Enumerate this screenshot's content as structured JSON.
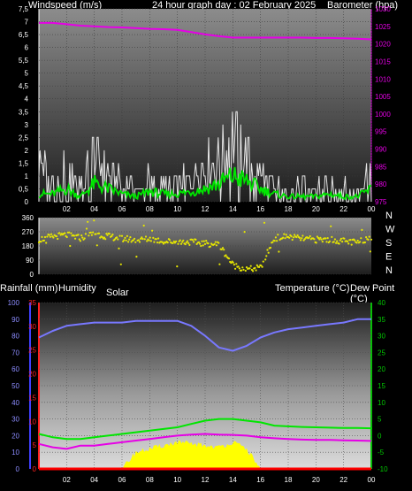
{
  "header": {
    "left": "Windspeed (m/s)",
    "center": "24 hour graph day : 02 February 2025",
    "right": "Barometer (hpa)"
  },
  "lower_header": {
    "rain": "Rainfall (mm)",
    "humidity": "Humidity",
    "solar": "Solar",
    "temperature": "Temperature (°C)",
    "dewpoint": "Dew Point (°C)"
  },
  "colors": {
    "wind_gust": "#e6e6e6",
    "wind_avg": "#00e600",
    "barometer": "#e600e6",
    "direction": "#e6e600",
    "humidity": "#7878ff",
    "temperature": "#00e600",
    "dewpoint": "#e600e6",
    "solar": "#ffff00",
    "rain": "#ff0000",
    "temp_axis": "#00c800",
    "hum_axis": "#4040ff",
    "rain_axis": "#ff2020"
  },
  "chart_data": [
    {
      "type": "line",
      "id": "wind-baro",
      "x_ticks": [
        "02",
        "04",
        "06",
        "08",
        "10",
        "12",
        "14",
        "16",
        "18",
        "20",
        "22",
        "00"
      ],
      "y_left": {
        "label": "Windspeed (m/s)",
        "ylim": [
          0,
          7.5
        ],
        "ticks": [
          "0",
          "0,5",
          "1",
          "1,5",
          "2",
          "2,5",
          "3",
          "3,5",
          "4",
          "4,5",
          "5",
          "5,5",
          "6",
          "6,5",
          "7",
          "7,5"
        ]
      },
      "y_right": {
        "label": "Barometer (hpa)",
        "ylim": [
          975,
          1030
        ],
        "ticks": [
          "975",
          "980",
          "985",
          "990",
          "995",
          "1000",
          "1005",
          "1010",
          "1015",
          "1020",
          "1025",
          "1030"
        ]
      },
      "x": [
        0,
        1,
        2,
        3,
        4,
        5,
        6,
        7,
        8,
        9,
        10,
        11,
        12,
        13,
        14,
        15,
        16,
        17,
        18,
        19,
        20,
        21,
        22,
        23,
        24
      ],
      "series": [
        {
          "name": "gust",
          "axis": "left",
          "values": [
            1.8,
            1.0,
            1.5,
            0.8,
            2.0,
            1.2,
            0.8,
            0.5,
            1.0,
            0.6,
            0.8,
            1.0,
            1.5,
            1.8,
            2.8,
            2.0,
            1.2,
            0.6,
            0.5,
            0.8,
            0.6,
            0.7,
            0.6,
            0.5,
            1.5
          ]
        },
        {
          "name": "average",
          "axis": "left",
          "values": [
            0.3,
            0.3,
            0.5,
            0.2,
            0.7,
            0.5,
            0.3,
            0.2,
            0.4,
            0.3,
            0.3,
            0.4,
            0.5,
            0.7,
            1.0,
            0.8,
            0.5,
            0.3,
            0.2,
            0.2,
            0.2,
            0.3,
            0.2,
            0.2,
            0.5
          ]
        },
        {
          "name": "barometer",
          "axis": "right",
          "values": [
            1026,
            1026,
            1025.6,
            1025.2,
            1025,
            1024.8,
            1024.7,
            1024.5,
            1024.3,
            1024.2,
            1024,
            1023.4,
            1022.7,
            1022.2,
            1021.8,
            1021.8,
            1021.8,
            1021.8,
            1021.8,
            1021.8,
            1021.7,
            1021.7,
            1021.6,
            1021.5,
            1021.3
          ]
        }
      ]
    },
    {
      "type": "scatter",
      "id": "direction",
      "x_ticks": [
        "02",
        "04",
        "06",
        "08",
        "10",
        "12",
        "14",
        "16",
        "18",
        "20",
        "22",
        "00"
      ],
      "y_left": {
        "ylim": [
          0,
          360
        ],
        "ticks": [
          "0",
          "90",
          "180",
          "270",
          "360"
        ]
      },
      "y_right_labels": [
        "N",
        "W",
        "S",
        "E",
        "N"
      ],
      "x": [
        0,
        1,
        2,
        3,
        4,
        5,
        6,
        7,
        8,
        9,
        10,
        11,
        12,
        13,
        14,
        15,
        16,
        17,
        18,
        19,
        20,
        21,
        22,
        23,
        24
      ],
      "series": [
        {
          "name": "direction",
          "values": [
            220,
            240,
            250,
            230,
            260,
            240,
            230,
            215,
            225,
            210,
            205,
            205,
            195,
            190,
            60,
            30,
            40,
            230,
            240,
            225,
            220,
            220,
            210,
            200,
            240
          ]
        }
      ]
    },
    {
      "type": "line",
      "id": "temp-hum",
      "x_ticks": [
        "02",
        "04",
        "06",
        "08",
        "10",
        "12",
        "14",
        "16",
        "18",
        "20",
        "22",
        "00"
      ],
      "y_humidity": {
        "label": "Humidity",
        "ylim": [
          0,
          100
        ],
        "ticks": [
          "0",
          "10",
          "20",
          "30",
          "40",
          "50",
          "60",
          "70",
          "80",
          "90",
          "100"
        ]
      },
      "y_rain": {
        "label": "Rainfall (mm)",
        "ylim": [
          0,
          35
        ],
        "ticks": [
          "0",
          "5",
          "10",
          "15",
          "20",
          "25",
          "30",
          "35"
        ]
      },
      "y_temp": {
        "label": "Temperature (°C)",
        "ylim": [
          -10,
          40
        ],
        "ticks": [
          "-10",
          "-5",
          "0",
          "5",
          "10",
          "15",
          "20",
          "25",
          "30",
          "35",
          "40"
        ]
      },
      "x": [
        0,
        1,
        2,
        3,
        4,
        5,
        6,
        7,
        8,
        9,
        10,
        11,
        12,
        13,
        14,
        15,
        16,
        17,
        18,
        19,
        20,
        21,
        22,
        23,
        24
      ],
      "series": [
        {
          "name": "humidity",
          "axis": "humidity",
          "values": [
            79,
            83,
            86,
            87,
            88,
            88,
            88,
            89,
            89,
            89,
            89,
            86,
            80,
            73,
            71,
            74,
            79,
            82,
            84,
            85,
            86,
            87,
            88,
            90,
            90
          ]
        },
        {
          "name": "temperature",
          "axis": "temp",
          "values": [
            0.5,
            -0.5,
            -1,
            -1,
            -0.5,
            0,
            0.5,
            1,
            1.5,
            2,
            2.5,
            3.5,
            4.5,
            5,
            5,
            4.5,
            4,
            3,
            2.8,
            2.6,
            2.5,
            2.4,
            2.3,
            2.3,
            2.2
          ]
        },
        {
          "name": "dewpoint",
          "axis": "temp",
          "values": [
            -2.5,
            -3.5,
            -4,
            -3,
            -3,
            -2.5,
            -2,
            -1.5,
            -1,
            -0.5,
            0,
            0.3,
            0.5,
            0.3,
            0.2,
            0,
            -0.5,
            -0.8,
            -1,
            -1.2,
            -1.3,
            -1.3,
            -1.4,
            -1.5,
            -1.6
          ]
        },
        {
          "name": "solar",
          "axis": "temp",
          "values": [
            -10,
            -10,
            -10,
            -10,
            -10,
            -10,
            -10,
            -5,
            -4,
            -3,
            -2,
            -2.5,
            -3,
            -3.5,
            -2,
            -4,
            -10,
            -10,
            -10,
            -10,
            -10,
            -10,
            -10,
            -10,
            -10
          ]
        },
        {
          "name": "rain",
          "axis": "rain",
          "values": [
            0,
            0,
            0,
            0,
            0,
            0,
            0,
            0,
            0,
            0,
            0,
            0,
            0,
            0,
            0,
            0,
            0,
            0,
            0,
            0,
            0,
            0,
            0,
            0,
            0
          ]
        }
      ]
    }
  ]
}
